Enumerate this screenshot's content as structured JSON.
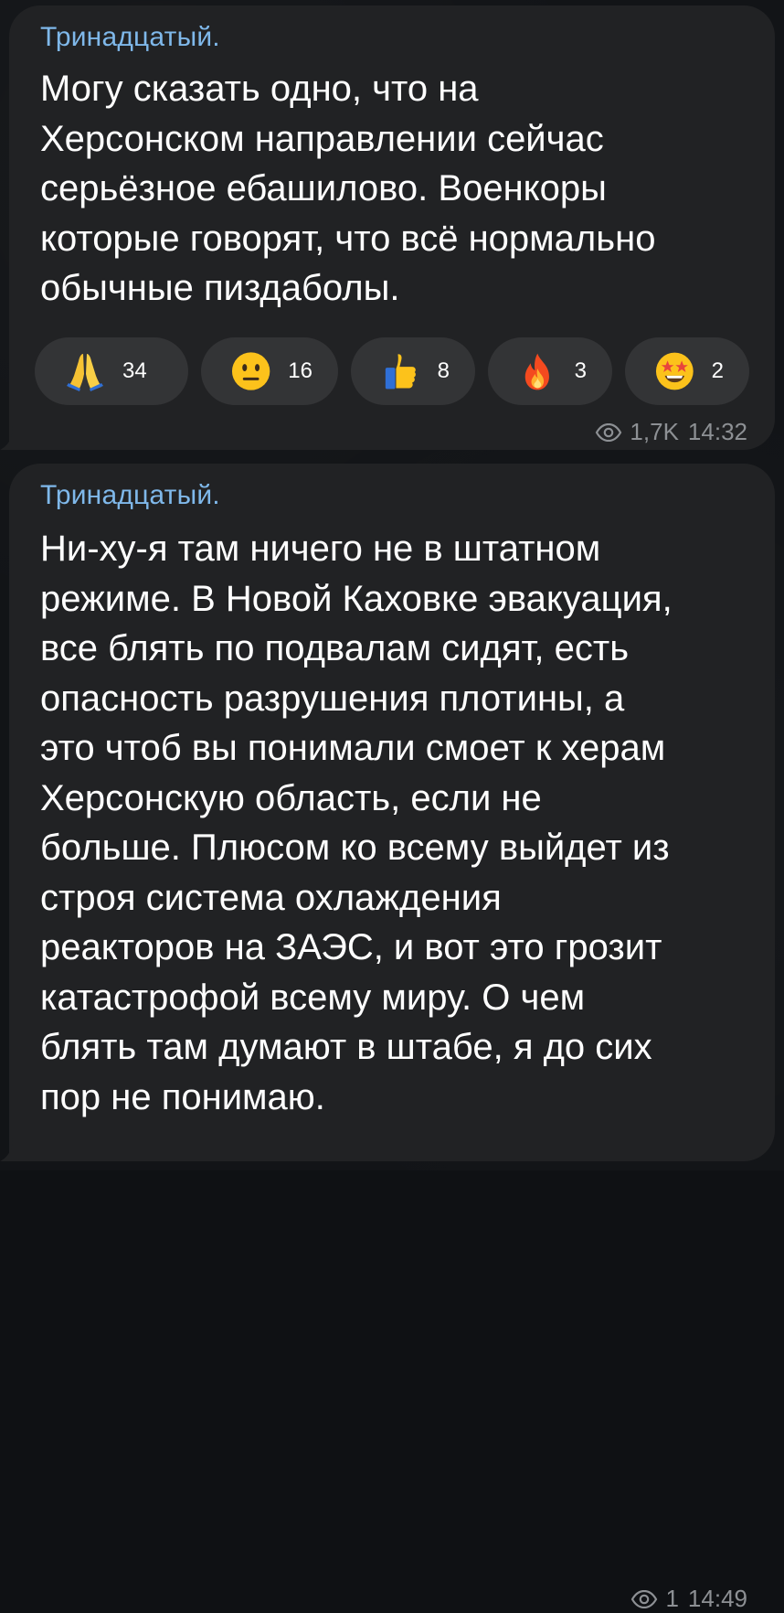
{
  "messages": [
    {
      "sender": "Тринадцатый.",
      "text": "Могу сказать одно, что на\nХерсонском направлении сейчас\nсерьёзное ебашилово. Военкоры\nкоторые говорят, что всё нормально\nобычные пиздаболы.",
      "reactions": [
        {
          "icon": "praying-hands-emoji",
          "count": "34"
        },
        {
          "icon": "neutral-face-emoji",
          "count": "16"
        },
        {
          "icon": "thumbs-up-emoji",
          "count": "8"
        },
        {
          "icon": "fire-emoji",
          "count": "3"
        },
        {
          "icon": "star-struck-emoji",
          "count": "2"
        }
      ],
      "views": "1,7K",
      "time": "14:32"
    },
    {
      "sender": "Тринадцатый.",
      "text": "Ни-ху-я там ничего не в штатном\nрежиме. В Новой Каховке эвакуация,\nвсе блять по подвалам сидят, есть\nопасность разрушения плотины, а\nэто чтоб вы понимали смоет к херам\nХерсонскую область, если не\nбольше. Плюсом ко всему выйдет из\nстроя система охлаждения\nреакторов на ЗАЭС, и вот это грозит\nкатастрофой всему миру. О чем\nблять там думают в штабе, я до сих\nпор не понимаю.",
      "views": "1",
      "time": "14:49"
    }
  ],
  "colors": {
    "background": "#121417",
    "bubble": "#212224",
    "sender": "#7fb8ea",
    "text": "#ffffff",
    "meta": "#8d9094",
    "reaction_pill": "#333436"
  }
}
